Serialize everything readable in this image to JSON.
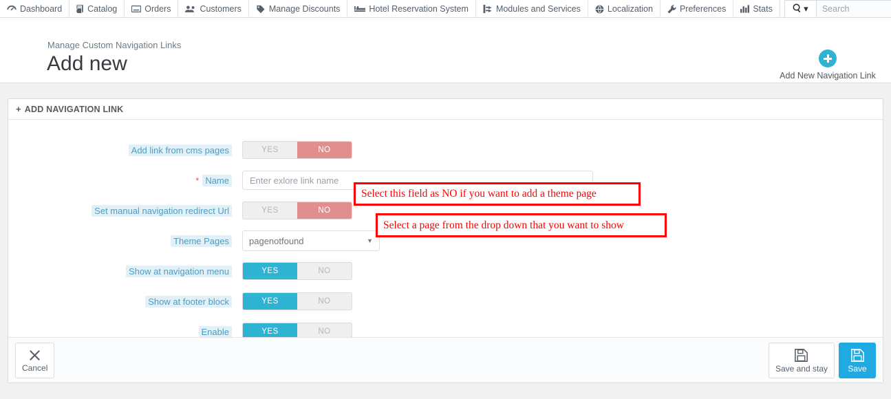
{
  "topnav": {
    "items": [
      {
        "label": "Dashboard",
        "icon": "dashboard-icon"
      },
      {
        "label": "Catalog",
        "icon": "book-icon"
      },
      {
        "label": "Orders",
        "icon": "orders-icon"
      },
      {
        "label": "Customers",
        "icon": "customers-icon"
      },
      {
        "label": "Manage Discounts",
        "icon": "tag-icon"
      },
      {
        "label": "Hotel Reservation System",
        "icon": "bed-icon"
      },
      {
        "label": "Modules and Services",
        "icon": "plug-icon"
      },
      {
        "label": "Localization",
        "icon": "globe-icon"
      },
      {
        "label": "Preferences",
        "icon": "wrench-icon"
      },
      {
        "label": "Stats",
        "icon": "bar-chart-icon"
      }
    ],
    "search": {
      "placeholder": "Search",
      "value": ""
    },
    "overflow": "•••"
  },
  "header": {
    "breadcrumb": "Manage Custom Navigation Links",
    "title": "Add new",
    "action_label": "Add New Navigation Link"
  },
  "panel": {
    "title": "ADD NAVIGATION LINK",
    "plus": "+"
  },
  "form": {
    "rows": [
      {
        "label": "Add link from cms pages",
        "required": false,
        "type": "toggle",
        "yes": "YES",
        "no": "NO",
        "value": "NO"
      },
      {
        "label": "Name",
        "required": true,
        "type": "text",
        "placeholder": "Enter exlore link name",
        "value": ""
      },
      {
        "label": "Set manual navigation redirect Url",
        "required": false,
        "type": "toggle",
        "yes": "YES",
        "no": "NO",
        "value": "NO"
      },
      {
        "label": "Theme Pages",
        "required": false,
        "type": "select",
        "value": "pagenotfound",
        "caret": "▼"
      },
      {
        "label": "Show at navigation menu",
        "required": false,
        "type": "toggle",
        "yes": "YES",
        "no": "NO",
        "value": "YES"
      },
      {
        "label": "Show at footer block",
        "required": false,
        "type": "toggle",
        "yes": "YES",
        "no": "NO",
        "value": "YES"
      },
      {
        "label": "Enable",
        "required": false,
        "type": "toggle",
        "yes": "YES",
        "no": "NO",
        "value": "YES"
      }
    ],
    "required_marker": "*"
  },
  "annotations": [
    {
      "text": "Select this field as NO if you want to add a theme page"
    },
    {
      "text": "Select a page from the drop down that you want to show"
    }
  ],
  "footer": {
    "cancel": "Cancel",
    "save_and_stay": "Save and stay",
    "save": "Save"
  },
  "colors": {
    "accent_cyan": "#2eb3d2",
    "toggle_no_red": "#e08e8e",
    "save_blue": "#21a9e1",
    "annotation_red": "#ff0000",
    "label_blue": "#4f9cbe"
  }
}
